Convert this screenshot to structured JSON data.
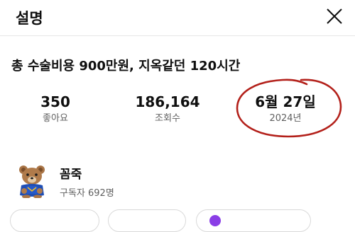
{
  "header": {
    "title": "설명",
    "close_icon": "close-icon"
  },
  "video": {
    "title": "총 수술비용 900만원, 지옥같던 120시간"
  },
  "stats": {
    "likes": {
      "value": "350",
      "label": "좋아요"
    },
    "views": {
      "value": "186,164",
      "label": "조회수"
    },
    "date": {
      "value": "6월 27일",
      "label": "2024년"
    }
  },
  "annotation": {
    "color": "#b3201a"
  },
  "channel": {
    "name": "꼼죽",
    "subscribers": "구독자 692명",
    "avatar_icon": "teddy-bear-avatar-icon"
  },
  "colors": {
    "text_primary": "#0f0f0f",
    "text_secondary": "#606060",
    "pill_accent": "#8a3ee6"
  }
}
